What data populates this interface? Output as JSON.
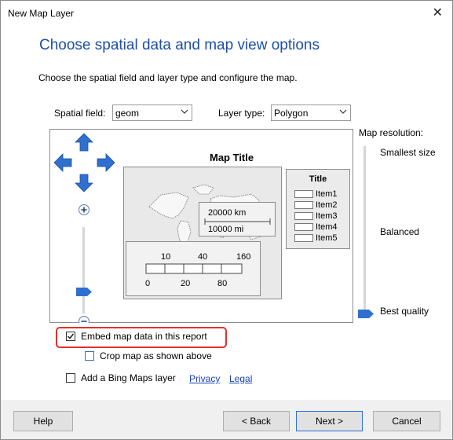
{
  "window": {
    "title": "New Map Layer"
  },
  "header": {
    "heading": "Choose spatial data and map view options",
    "description": "Choose the spatial field and layer type and configure the map."
  },
  "spatial_field": {
    "label": "Spatial field:",
    "value": "geom"
  },
  "layer_type": {
    "label": "Layer type:",
    "value": "Polygon"
  },
  "preview": {
    "map_title": "Map Title",
    "legend": {
      "title": "Title",
      "items": [
        "Item1",
        "Item2",
        "Item3",
        "Item4",
        "Item5"
      ]
    },
    "distance_scale": {
      "km": "20000 km",
      "mi": "10000 mi"
    },
    "color_scale": {
      "top_ticks": [
        "10",
        "40",
        "160"
      ],
      "bottom_ticks": [
        "0",
        "20",
        "80"
      ]
    }
  },
  "resolution": {
    "label": "Map resolution:",
    "levels": [
      "Smallest size",
      "Balanced",
      "Best quality"
    ],
    "selected": "Best quality"
  },
  "options": {
    "embed": {
      "label": "Embed map data in this report",
      "checked": true
    },
    "crop": {
      "label": "Crop map as shown above",
      "checked": false
    },
    "bing": {
      "label": "Add a Bing Maps layer",
      "checked": false
    },
    "privacy_link": "Privacy",
    "legal_link": "Legal"
  },
  "buttons": {
    "help": "Help",
    "back": "< Back",
    "next": "Next >",
    "cancel": "Cancel"
  },
  "colors": {
    "accent": "#1f4fa8",
    "highlight": "#e0302f",
    "arrow": "#2e6fd0"
  }
}
